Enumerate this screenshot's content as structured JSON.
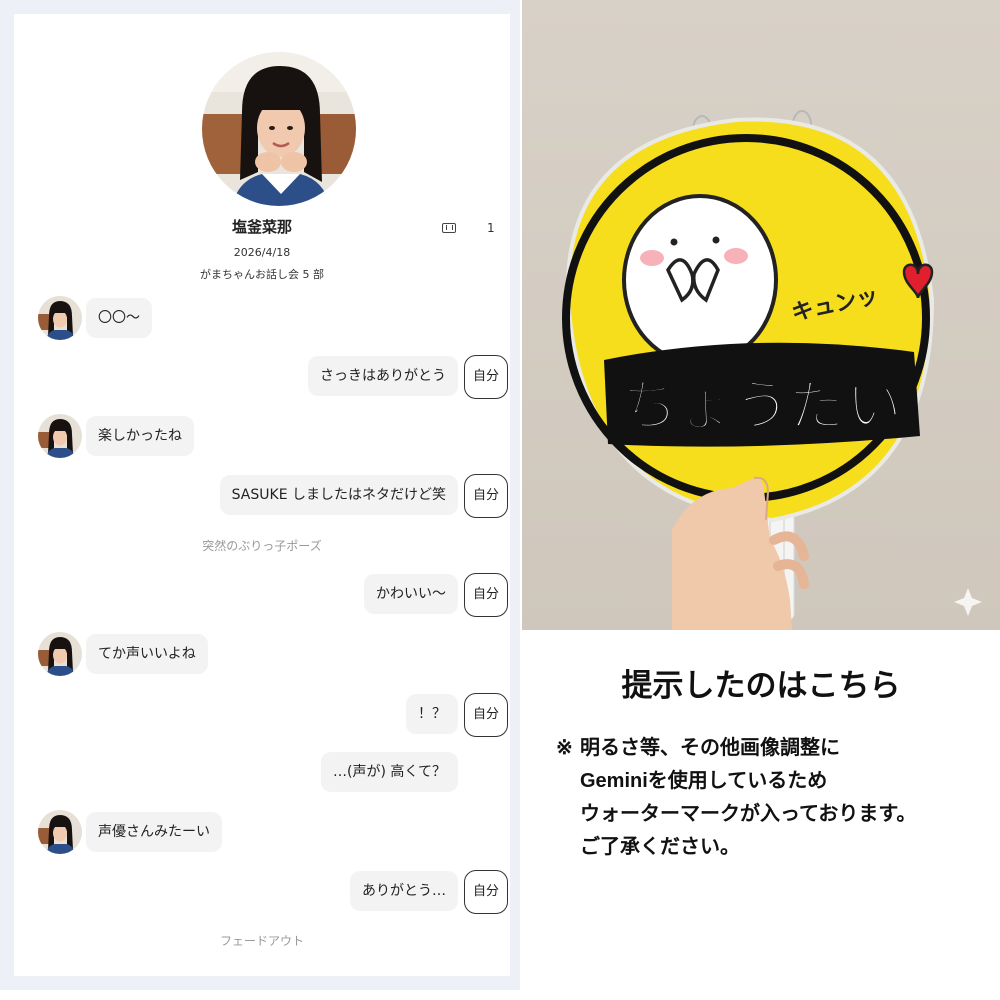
{
  "profile": {
    "name": "塩釜菜那",
    "ticket_count": "1",
    "date": "2026/4/18",
    "session": "がまちゃんお話し会 5 部"
  },
  "messages": [
    {
      "side": "left",
      "text": "〇〇〜"
    },
    {
      "side": "right",
      "text": "さっきはありがとう",
      "tag": "自分"
    },
    {
      "side": "left",
      "text": "楽しかったね"
    },
    {
      "side": "right",
      "text": "SASUKE しましたはネタだけど笑",
      "tag": "自分"
    },
    {
      "side": "note",
      "text": "突然のぶりっ子ポーズ"
    },
    {
      "side": "right",
      "text": "かわいい〜",
      "tag": "自分"
    },
    {
      "side": "left",
      "text": "てか声いいよね"
    },
    {
      "side": "right",
      "text": "！？",
      "tag": "自分"
    },
    {
      "side": "right",
      "text": "…(声が) 高くて？"
    },
    {
      "side": "left",
      "text": "声優さんみたーい"
    },
    {
      "side": "right",
      "text": "ありがとう…",
      "tag": "自分"
    },
    {
      "side": "note",
      "text": "フェードアウト"
    }
  ],
  "photo": {
    "fan_main_text": "ちょうだい",
    "fan_sub_text": "キュンッ"
  },
  "caption": {
    "title": "提示したのはこちら",
    "note_mark": "※",
    "note_lines": [
      "明るさ等、その他画像調整に",
      "Geminiを使用しているため",
      "ウォーターマークが入っております。",
      "ご了承ください。"
    ]
  },
  "colors": {
    "fan_yellow": "#f7de1c",
    "heart_red": "#e0202e",
    "bubble_gray": "#f3f3f3",
    "frame_lavender": "#eef0f8"
  }
}
